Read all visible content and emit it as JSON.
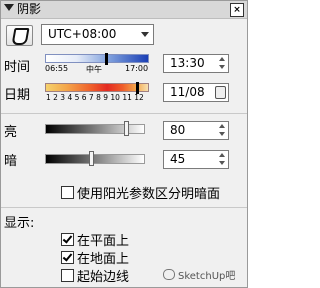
{
  "title": "阴影",
  "close_glyph": "×",
  "timezone": "UTC+08:00",
  "time": {
    "label": "时间",
    "slider_value": 0.62,
    "ticks": [
      "06:55",
      "中午",
      "17:00"
    ],
    "value": "13:30"
  },
  "date": {
    "label": "日期",
    "slider_value": 0.9,
    "ticks": "1 2 3 4 5 6 7 8 9 10 11 12",
    "value": "11/08"
  },
  "light": {
    "label": "亮",
    "slider_value": 0.8,
    "value": "80"
  },
  "dark": {
    "label": "暗",
    "slider_value": 0.45,
    "value": "45"
  },
  "use_sun_checkbox": {
    "label": "使用阳光参数区分明暗面",
    "checked": false
  },
  "display": {
    "header": "显示:",
    "items": [
      {
        "label": "在平面上",
        "checked": true
      },
      {
        "label": "在地面上",
        "checked": true
      },
      {
        "label": "起始边线",
        "checked": false
      }
    ]
  },
  "watermark": "SketchUp吧",
  "colors": {
    "title_bg": "#d8d8d8",
    "panel_bg": "#f0f0f0",
    "time_bar_end": "#1a3fb5",
    "date_bar_peak": "#e42a22"
  }
}
